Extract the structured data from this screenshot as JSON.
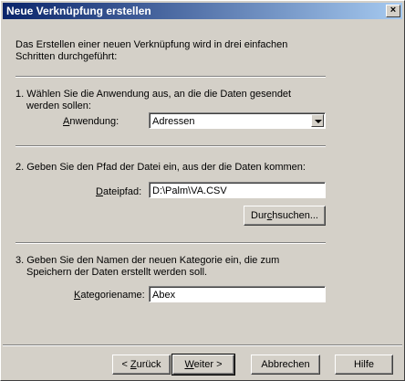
{
  "window": {
    "title": "Neue Verknüpfung erstellen",
    "close_symbol": "×"
  },
  "intro": {
    "line1": "Das Erstellen einer neuen Verknüpfung wird in drei einfachen",
    "line2": "Schritten durchgeführt:"
  },
  "step1": {
    "line1": "1.  Wählen Sie die Anwendung aus, an die die Daten gesendet",
    "line2": "werden sollen:",
    "label_accel": "A",
    "label_rest": "nwendung:",
    "value": "Adressen"
  },
  "step2": {
    "line1": "2.  Geben Sie den Pfad der Datei ein, aus der die Daten kommen:",
    "label_accel": "D",
    "label_rest": "ateipfad:",
    "value": "D:\\Palm\\VA.CSV",
    "browse_pre": "Dur",
    "browse_accel": "c",
    "browse_post": "hsuchen..."
  },
  "step3": {
    "line1": "3.  Geben Sie den Namen der neuen Kategorie ein, die zum",
    "line2": "Speichern der Daten erstellt werden soll.",
    "label_accel": "K",
    "label_rest": "ategoriename:",
    "value": "Abex"
  },
  "buttons": {
    "back_pre": "< ",
    "back_accel": "Z",
    "back_post": "urück",
    "next_accel": "W",
    "next_post": "eiter >",
    "cancel": "Abbrechen",
    "help": "Hilfe"
  },
  "icons": {
    "close": "close-icon",
    "dropdown": "chevron-down-icon"
  }
}
